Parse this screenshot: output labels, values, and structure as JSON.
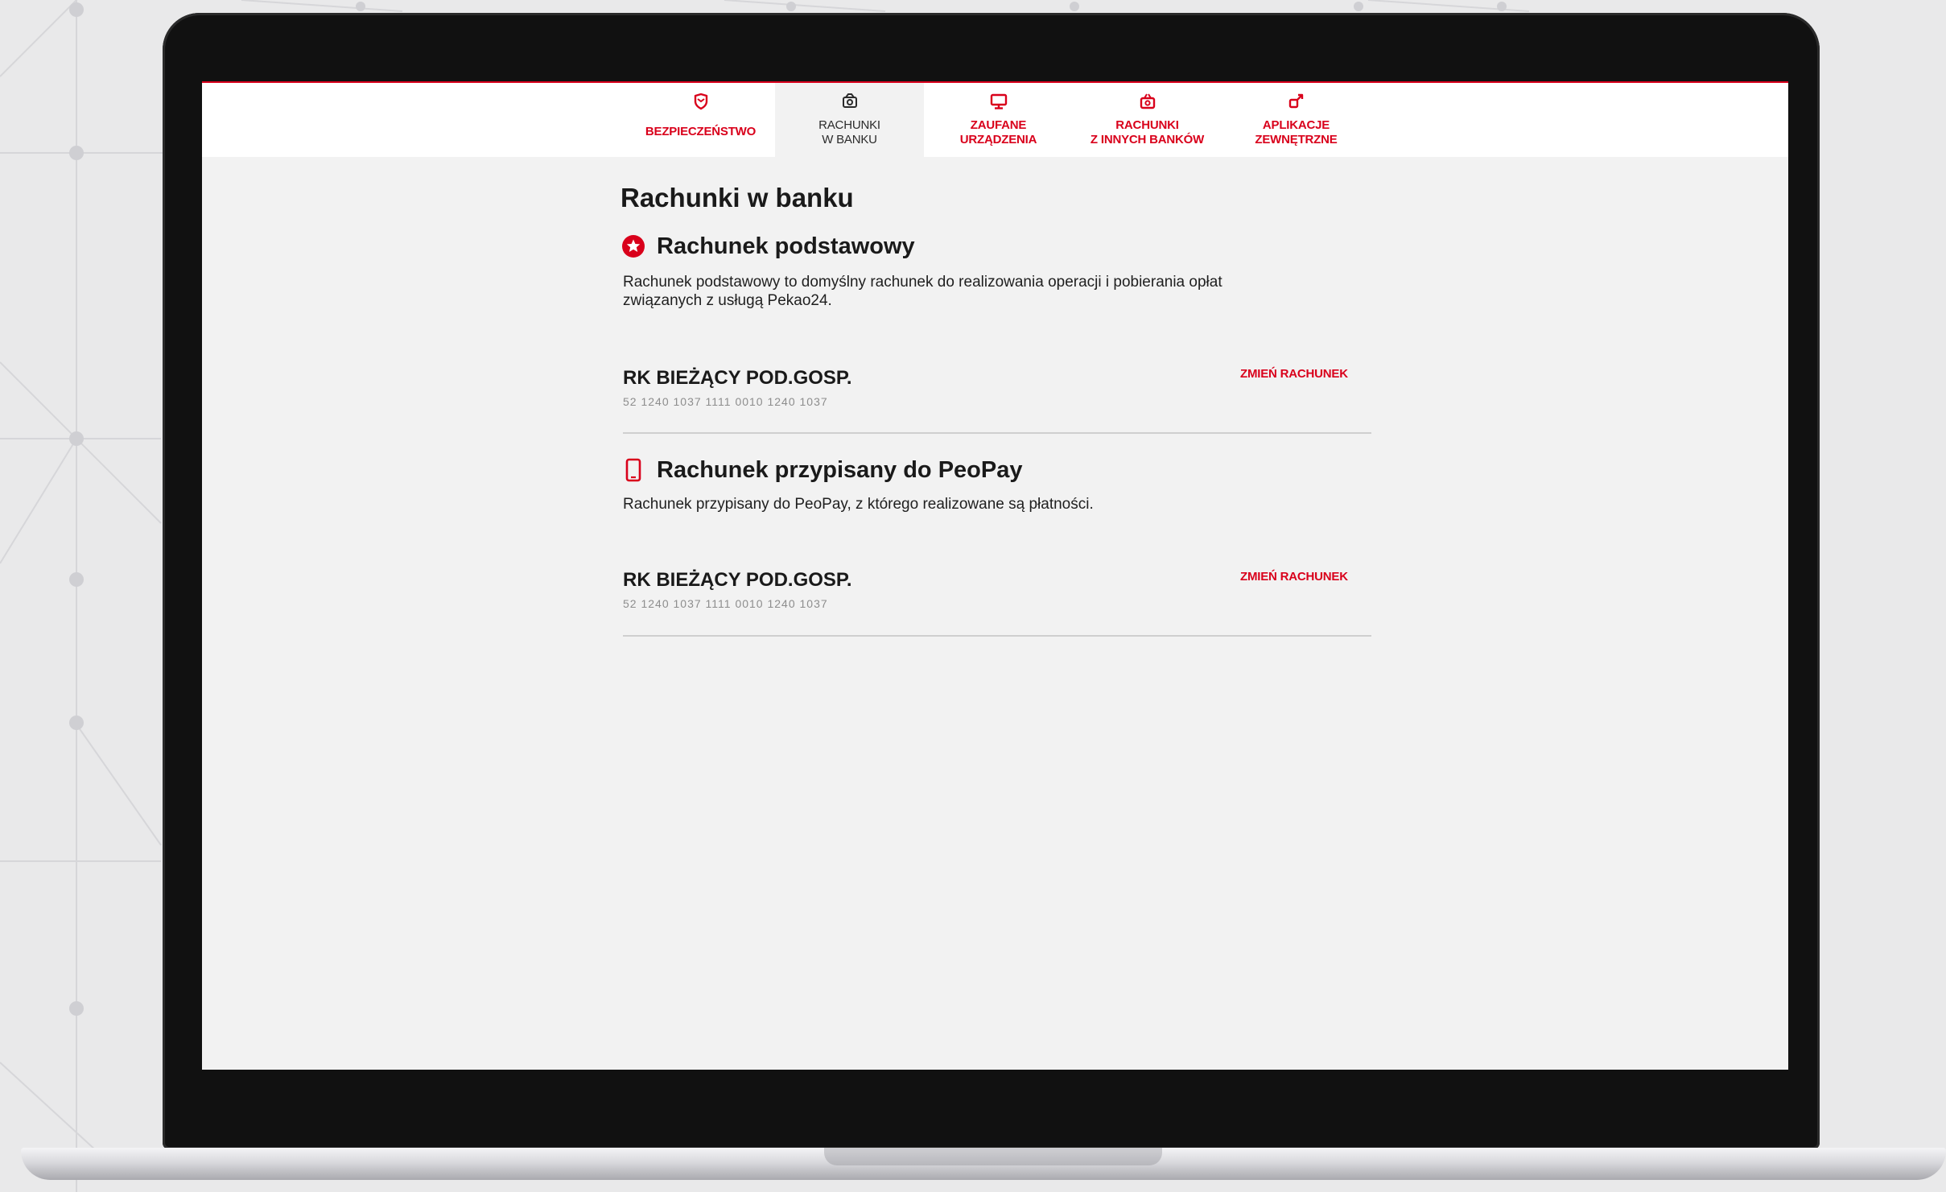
{
  "colors": {
    "accent": "#d9001b",
    "screen_bg": "#f2f2f2",
    "nav_bg": "#ffffff",
    "text": "#1a1a1a",
    "muted": "#8d8d8d"
  },
  "nav": {
    "tabs": [
      {
        "label_line1": "BEZPIECZEŃSTWO",
        "label_line2": "",
        "icon": "shield-icon",
        "active": false
      },
      {
        "label_line1": "RACHUNKI",
        "label_line2": "W BANKU",
        "icon": "bank-accounts-icon",
        "active": true
      },
      {
        "label_line1": "ZAUFANE",
        "label_line2": "URZĄDZENIA",
        "icon": "monitor-icon",
        "active": false
      },
      {
        "label_line1": "RACHUNKI",
        "label_line2": "Z INNYCH BANKÓW",
        "icon": "external-accounts-icon",
        "active": false
      },
      {
        "label_line1": "APLIKACJE",
        "label_line2": "ZEWNĘTRZNE",
        "icon": "external-apps-icon",
        "active": false
      }
    ]
  },
  "main": {
    "title": "Rachunki w banku",
    "sections": [
      {
        "icon": "star-badge-icon",
        "title": "Rachunek podstawowy",
        "description_line1": "Rachunek podstawowy to domyślny rachunek do realizowania operacji i pobierania opłat",
        "description_line2": "związanych z usługą Pekao24.",
        "account_name": "RK BIEŻĄCY POD.GOSP.",
        "account_number": "52 1240 1037 1111 0010 1240 1037",
        "change_label": "ZMIEŃ RACHUNEK"
      },
      {
        "icon": "phone-icon",
        "title": "Rachunek przypisany do PeoPay",
        "description_line1": "Rachunek przypisany do PeoPay, z którego realizowane są płatności.",
        "description_line2": "",
        "account_name": "RK BIEŻĄCY POD.GOSP.",
        "account_number": "52 1240 1037 1111 0010 1240 1037",
        "change_label": "ZMIEŃ RACHUNEK"
      }
    ]
  }
}
